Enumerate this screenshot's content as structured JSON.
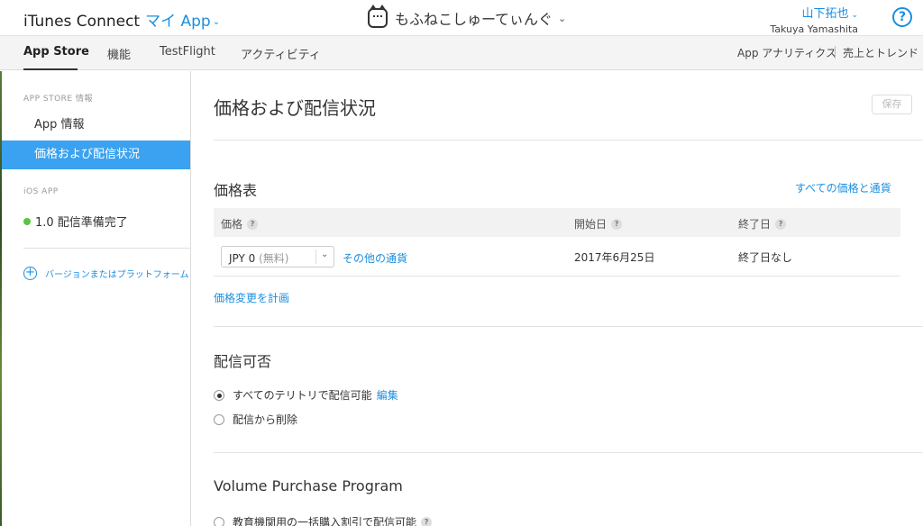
{
  "topbar": {
    "brand": "iTunes Connect",
    "my_app": "マイ App",
    "app_name": "もふねこしゅーてぃんぐ",
    "user_name": "山下拓也",
    "user_romaji": "Takuya Yamashita",
    "help": "?"
  },
  "nav": {
    "tabs": [
      {
        "label": "App Store"
      },
      {
        "label": "機能"
      },
      {
        "label": "TestFlight"
      },
      {
        "label": "アクティビティ"
      }
    ],
    "right_links": [
      {
        "label": "App アナリティクス"
      },
      {
        "label": "売上とトレンド"
      }
    ]
  },
  "sidebar": {
    "section1_heading": "APP STORE 情報",
    "items": [
      {
        "label": "App 情報"
      },
      {
        "label": "価格および配信状況"
      }
    ],
    "section2_heading": "iOS APP",
    "ios_version": "1.0 配信準備完了",
    "add_platform": "バージョンまたはプラットフォーム"
  },
  "main": {
    "title": "価格および配信状況",
    "save_label": "保存",
    "pricing": {
      "title": "価格表",
      "all_prices_link": "すべての価格と通貨",
      "headers": [
        "価格",
        "開始日",
        "終了日"
      ],
      "row": {
        "currency_code": "JPY 0",
        "currency_note": "(無料)",
        "other_currency_link": "その他の通貨",
        "start_date": "2017年6月25日",
        "end_date": "終了日なし"
      },
      "plan_change_link": "価格変更を計画"
    },
    "availability": {
      "title": "配信可否",
      "option_all": "すべてのテリトリで配信可能",
      "edit_link": "編集",
      "option_remove": "配信から削除"
    },
    "vpp": {
      "title": "Volume Purchase Program",
      "option_edu": "教育機関用の一括購入割引で配信可能"
    }
  }
}
